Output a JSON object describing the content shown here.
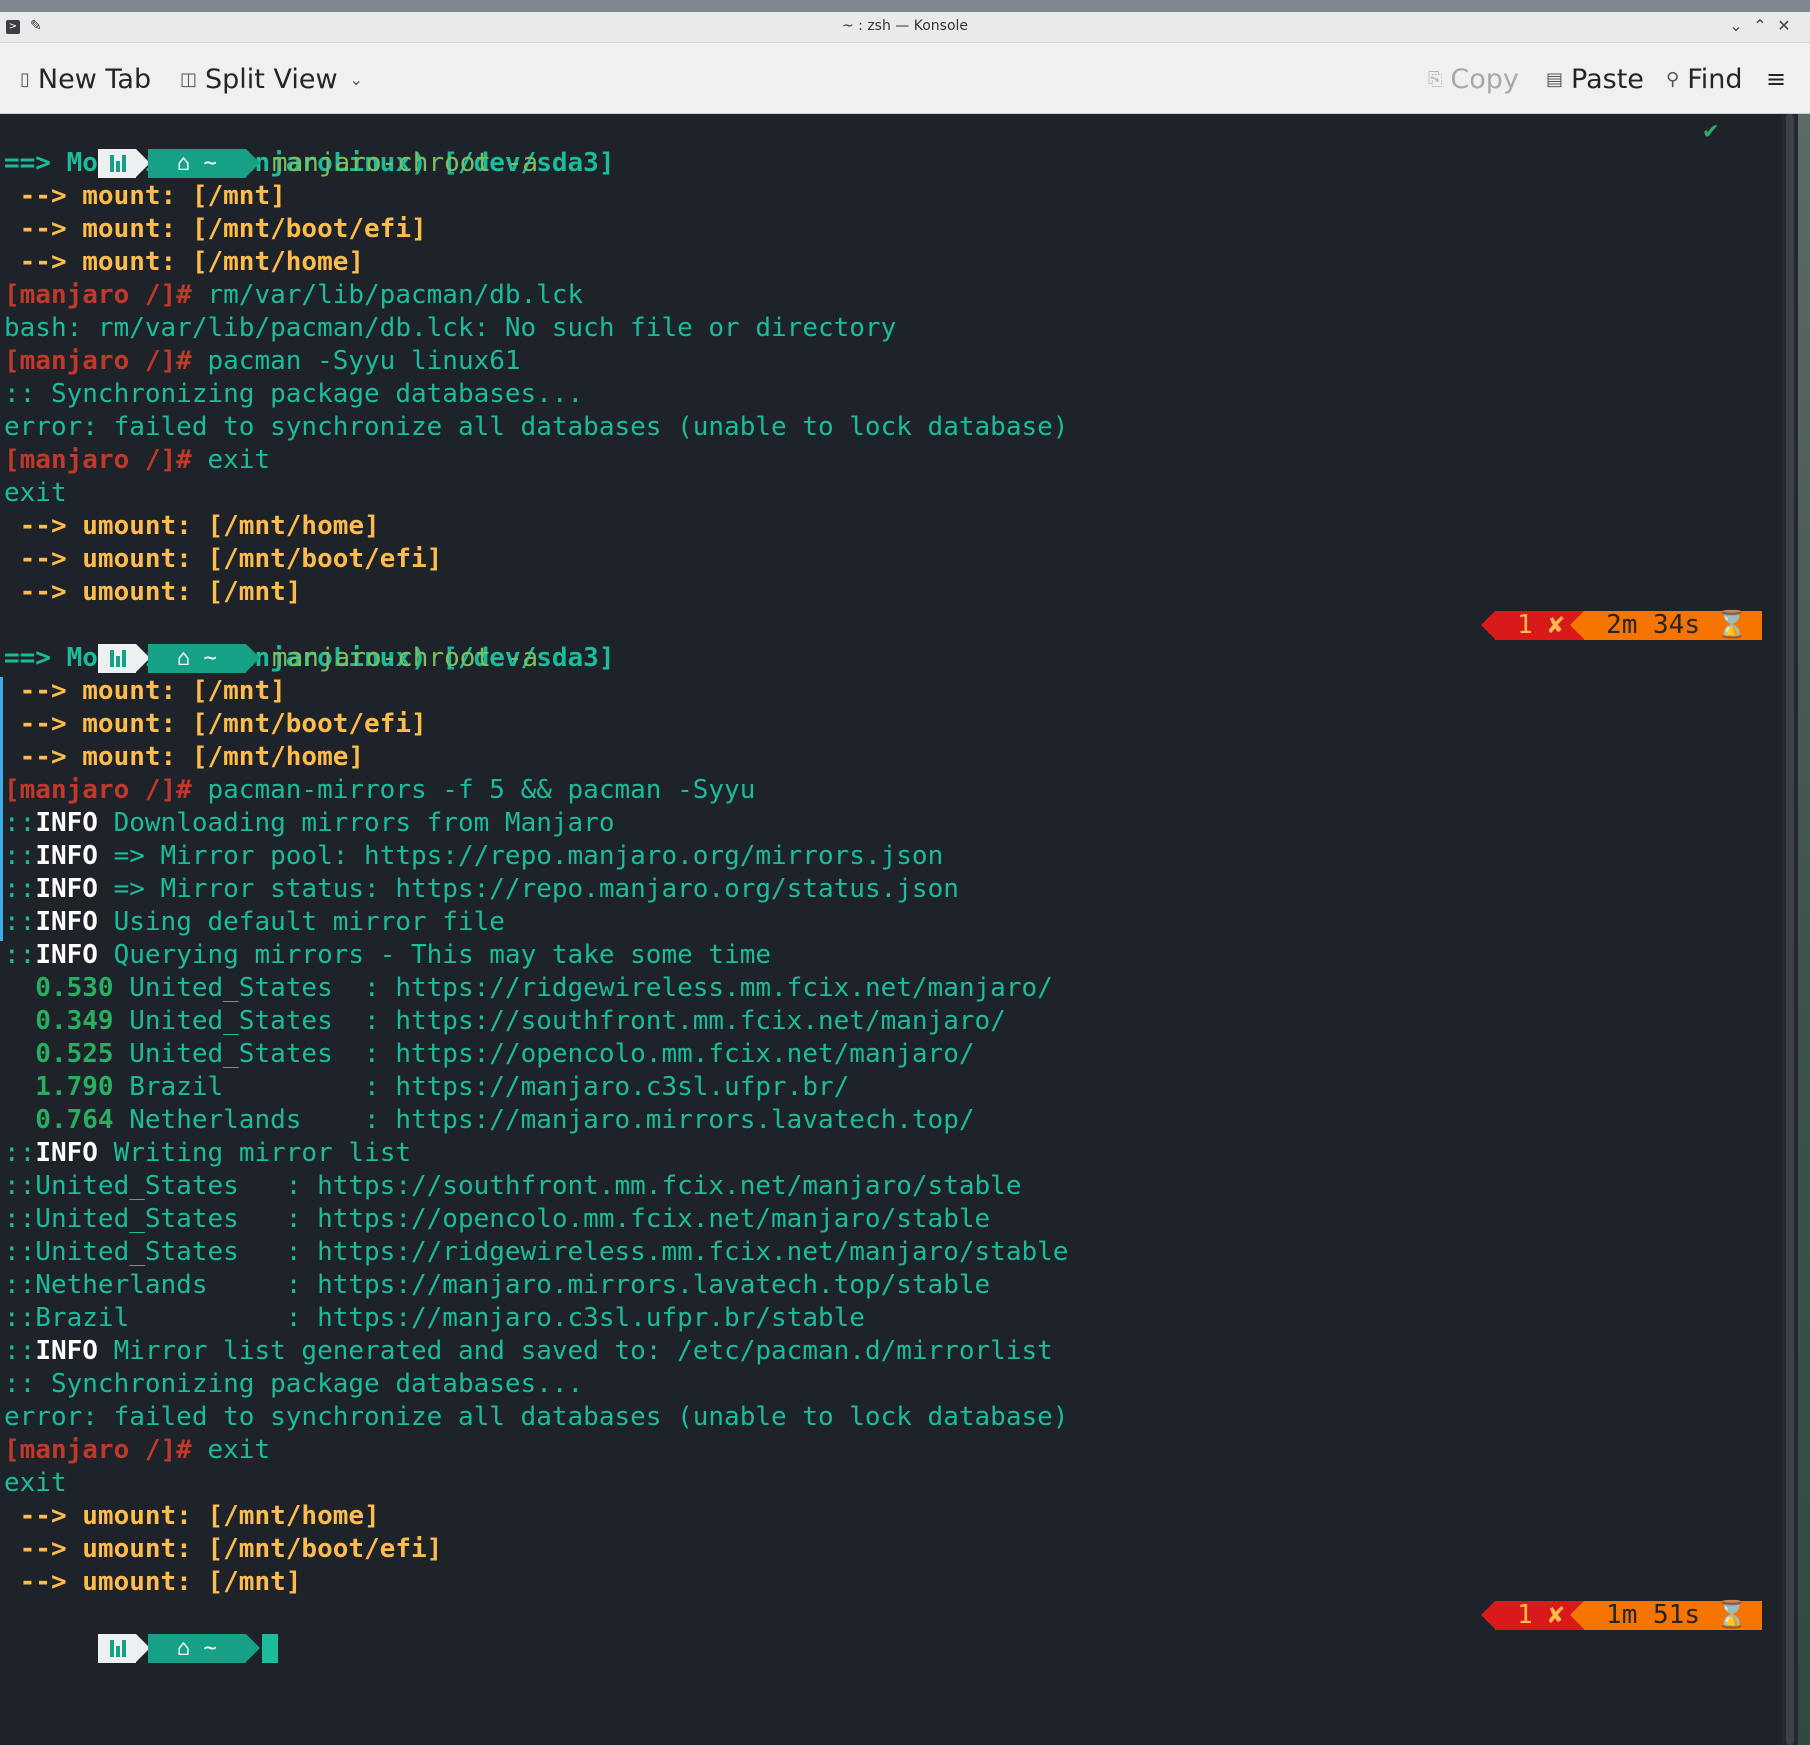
{
  "window": {
    "title": "~ : zsh — Konsole"
  },
  "toolbar": {
    "new_tab": "New Tab",
    "split_view": "Split View",
    "copy": "Copy",
    "paste": "Paste",
    "find": "Find"
  },
  "prompt": {
    "dir": "⌂ ~",
    "status_ok": "✔",
    "cmd1": "manjaro-chroot -a",
    "cmd2": "manjaro-chroot -a",
    "err_code": "1 ✘",
    "time2": "2m 34s",
    "time3": "1m 51s",
    "hourglass": "⌛"
  },
  "block1": {
    "mounting": "==> Mounting (ManjaroLinux) [/dev/sda3]",
    "m1": " --> mount: [/mnt]",
    "m2": " --> mount: [/mnt/boot/efi]",
    "m3": " --> mount: [/mnt/home]",
    "ps": "[manjaro /]#",
    "cmd_rm": " rm/var/lib/pacman/db.lck",
    "rm_err": "bash: rm/var/lib/pacman/db.lck: No such file or directory",
    "cmd_pacman": " pacman -Syyu linux61",
    "sync": ":: Synchronizing package databases...",
    "sync_err": "error: failed to synchronize all databases (unable to lock database)",
    "cmd_exit": " exit",
    "exit": "exit",
    "u1": " --> umount: [/mnt/home]",
    "u2": " --> umount: [/mnt/boot/efi]",
    "u3": " --> umount: [/mnt]"
  },
  "block2": {
    "mounting": "==> Mounting (ManjaroLinux) [/dev/sda3]",
    "m1": " --> mount: [/mnt]",
    "m2": " --> mount: [/mnt/boot/efi]",
    "m3": " --> mount: [/mnt/home]",
    "ps": "[manjaro /]#",
    "cmd_mirrors": " pacman-mirrors -f 5 && pacman -Syyu",
    "info_prefix": "::",
    "info": "INFO",
    "i1": " Downloading mirrors from Manjaro",
    "i2": " => Mirror pool: https://repo.manjaro.org/mirrors.json",
    "i3": " => Mirror status: https://repo.manjaro.org/status.json",
    "i4": " Using default mirror file",
    "i5": " Querying mirrors - This may take some time",
    "mirrors": [
      {
        "t": "  0.530",
        "rest": " United_States  : https://ridgewireless.mm.fcix.net/manjaro/"
      },
      {
        "t": "  0.349",
        "rest": " United_States  : https://southfront.mm.fcix.net/manjaro/"
      },
      {
        "t": "  0.525",
        "rest": " United_States  : https://opencolo.mm.fcix.net/manjaro/"
      },
      {
        "t": "  1.790",
        "rest": " Brazil         : https://manjaro.c3sl.ufpr.br/"
      },
      {
        "t": "  0.764",
        "rest": " Netherlands    : https://manjaro.mirrors.lavatech.top/"
      }
    ],
    "i6": " Writing mirror list",
    "list": [
      "::United_States   : https://southfront.mm.fcix.net/manjaro/stable",
      "::United_States   : https://opencolo.mm.fcix.net/manjaro/stable",
      "::United_States   : https://ridgewireless.mm.fcix.net/manjaro/stable",
      "::Netherlands     : https://manjaro.mirrors.lavatech.top/stable",
      "::Brazil          : https://manjaro.c3sl.ufpr.br/stable"
    ],
    "i7": " Mirror list generated and saved to: /etc/pacman.d/mirrorlist",
    "sync": ":: Synchronizing package databases...",
    "sync_err": "error: failed to synchronize all databases (unable to lock database)",
    "cmd_exit": " exit",
    "exit": "exit",
    "u1": " --> umount: [/mnt/home]",
    "u2": " --> umount: [/mnt/boot/efi]",
    "u3": " --> umount: [/mnt]"
  }
}
